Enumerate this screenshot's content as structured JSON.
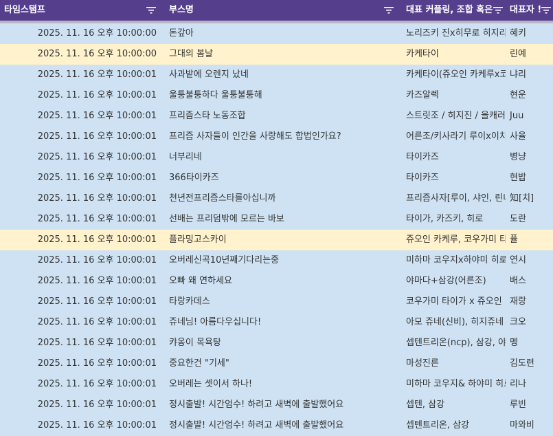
{
  "colors": {
    "header_bg": "#553e8c",
    "row_default": "#cfe2f3",
    "row_highlight": "#fff2cc"
  },
  "columns": [
    {
      "label": "타임스탬프"
    },
    {
      "label": "부스명"
    },
    {
      "label": "대표 커플링, 조합 혹은"
    },
    {
      "label": "대표자 !"
    }
  ],
  "rows": [
    {
      "ts": "2025. 11. 16 오후 10:00:00",
      "booth": "돈갚아",
      "couple": "노리즈키 진x히무로 히지리",
      "rep": "혜키",
      "highlight": false
    },
    {
      "ts": "2025. 11. 16 오후 10:00:00",
      "booth": "그대의 봄날",
      "couple": "카케타이",
      "rep": "린예",
      "highlight": true
    },
    {
      "ts": "2025. 11. 16 오후 10:00:01",
      "booth": "사과밭에 오렌지 났네",
      "couple": "카케타이(쥬오인 카케루x코",
      "rep": "냐리",
      "highlight": false
    },
    {
      "ts": "2025. 11. 16 오후 10:00:01",
      "booth": "울퉁불퉁하다 울퉁불퉁해",
      "couple": "카즈알렉",
      "rep": "현운",
      "highlight": false
    },
    {
      "ts": "2025. 11. 16 오후 10:00:01",
      "booth": "프리즘스타 노동조합",
      "couple": "스트릿조 / 히지진 / 올캐러",
      "rep": "Juu",
      "highlight": false
    },
    {
      "ts": "2025. 11. 16 오후 10:00:01",
      "booth": "프리즘 사자들이 인간을 사랑해도 합법인가요?",
      "couple": "어른조/키사라기 루이x이치",
      "rep": "사율",
      "highlight": false
    },
    {
      "ts": "2025. 11. 16 오후 10:00:01",
      "booth": "너부리네",
      "couple": "타이카즈",
      "rep": "병냥",
      "highlight": false
    },
    {
      "ts": "2025. 11. 16 오후 10:00:01",
      "booth": "366타이카즈",
      "couple": "타이카즈",
      "rep": "현밥",
      "highlight": false
    },
    {
      "ts": "2025. 11. 16 오후 10:00:01",
      "booth": "천년전프리즘스타를아십니까",
      "couple": "프리즘사자[루이, 샤인, 린네",
      "rep": "知[치]",
      "highlight": false
    },
    {
      "ts": "2025. 11. 16 오후 10:00:01",
      "booth": "선배는 프리덤밖에 모르는 바보",
      "couple": "타이가, 카즈키, 히로",
      "rep": "도란",
      "highlight": false
    },
    {
      "ts": "2025. 11. 16 오후 10:00:01",
      "booth": "플라밍고스카이",
      "couple": "쥬오인 카케루, 코우가미 타",
      "rep": "퓰",
      "highlight": true
    },
    {
      "ts": "2025. 11. 16 오후 10:00:01",
      "booth": "오버레신곡10년째기다리는중",
      "couple": "미하마 코우지x하야미 히로",
      "rep": "연시",
      "highlight": false
    },
    {
      "ts": "2025. 11. 16 오후 10:00:01",
      "booth": "오빠 왜 연하세요",
      "couple": "야마다+삼강(어른조)",
      "rep": "배스",
      "highlight": false
    },
    {
      "ts": "2025. 11. 16 오후 10:00:01",
      "booth": "타랑카데스",
      "couple": "코우가미 타이가 x 쥬오인",
      "rep": "재랑",
      "highlight": false
    },
    {
      "ts": "2025. 11. 16 오후 10:00:01",
      "booth": "쥬네님! 아름다우십니다!",
      "couple": "아모 쥬네(신비), 히지쥬네",
      "rep": "크오",
      "highlight": false
    },
    {
      "ts": "2025. 11. 16 오후 10:00:01",
      "booth": "캬옹이 목욕탕",
      "couple": "셉텐트리온(ncp), 삼강, 야마",
      "rep": "멩",
      "highlight": false
    },
    {
      "ts": "2025. 11. 16 오후 10:00:01",
      "booth": "중요한건 \"기세\"",
      "couple": "마성진른",
      "rep": "김도련",
      "highlight": false
    },
    {
      "ts": "2025. 11. 16 오후 10:00:01",
      "booth": "오버레는 셋이서 하나!",
      "couple": "미하마 코우지& 하야미 히로",
      "rep": "리나",
      "highlight": false
    },
    {
      "ts": "2025. 11. 16 오후 10:00:01",
      "booth": "정시출발! 시간엄수! 하려고 새벽에 출발했어요",
      "couple": "셉텐, 삼강",
      "rep": "루빈",
      "highlight": false
    },
    {
      "ts": "2025. 11. 16 오후 10:00:01",
      "booth": "정시출발! 시간엄수! 하려고 새벽에 출발했어요",
      "couple": "셉텐트리온, 삼강",
      "rep": "마와비",
      "highlight": false
    }
  ]
}
